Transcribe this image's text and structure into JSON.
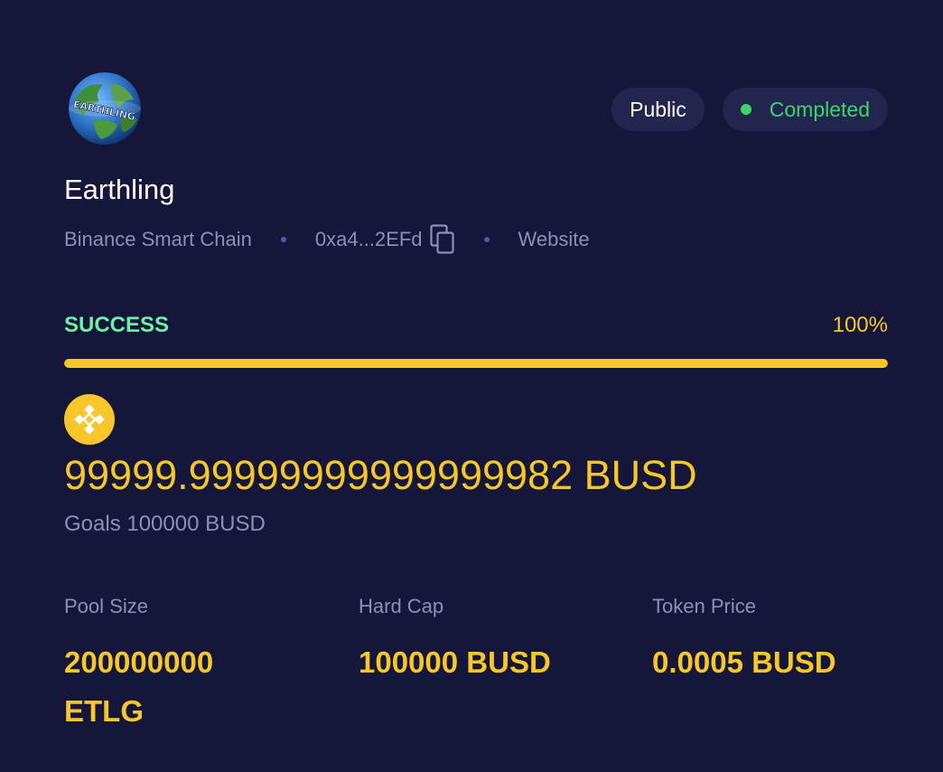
{
  "project": {
    "name": "Earthling",
    "logo_text": "EARTHLING",
    "chain": "Binance Smart Chain",
    "address_short": "0xa4...2EFd",
    "website_label": "Website"
  },
  "badges": {
    "public_label": "Public",
    "status_label": "Completed"
  },
  "progress": {
    "status": "SUCCESS",
    "percent_label": "100%",
    "fraction": 1.0
  },
  "raised": {
    "amount_label": "99999.99999999999999982 BUSD",
    "goal_label": "Goals 100000 BUSD"
  },
  "stats": {
    "pool_size": {
      "label": "Pool Size",
      "value": "200000000 ETLG"
    },
    "hard_cap": {
      "label": "Hard Cap",
      "value": "100000 BUSD"
    },
    "token_price": {
      "label": "Token Price",
      "value": "0.0005 BUSD"
    }
  },
  "icons": {
    "coin": "binance-coin-icon",
    "copy": "copy-icon",
    "status_dot": "status-dot-icon"
  },
  "colors": {
    "background": "#14163a",
    "accent": "#f7c62b",
    "success": "#6ff0a6",
    "completed": "#3fd46b",
    "muted": "#8d90b5"
  }
}
